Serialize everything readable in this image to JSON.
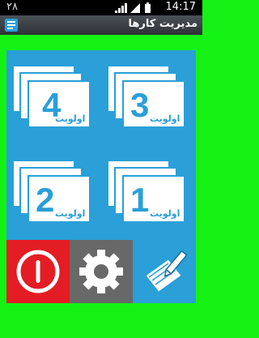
{
  "status_bar": {
    "left_number": "٢٨",
    "time": "14:17"
  },
  "title_bar": {
    "title": "مدیریت کارها"
  },
  "priorities": [
    {
      "number": "4",
      "label": "اولویت"
    },
    {
      "number": "3",
      "label": "اولویت"
    },
    {
      "number": "2",
      "label": "اولویت"
    },
    {
      "number": "1",
      "label": "اولویت"
    }
  ],
  "bottom_buttons": {
    "power": "power-icon",
    "settings": "gear-icon",
    "edit": "edit-note-icon"
  },
  "colors": {
    "background": "#14f214",
    "tile_blue": "#2a9fd8",
    "power_red": "#e41c24",
    "settings_gray": "#686868"
  }
}
